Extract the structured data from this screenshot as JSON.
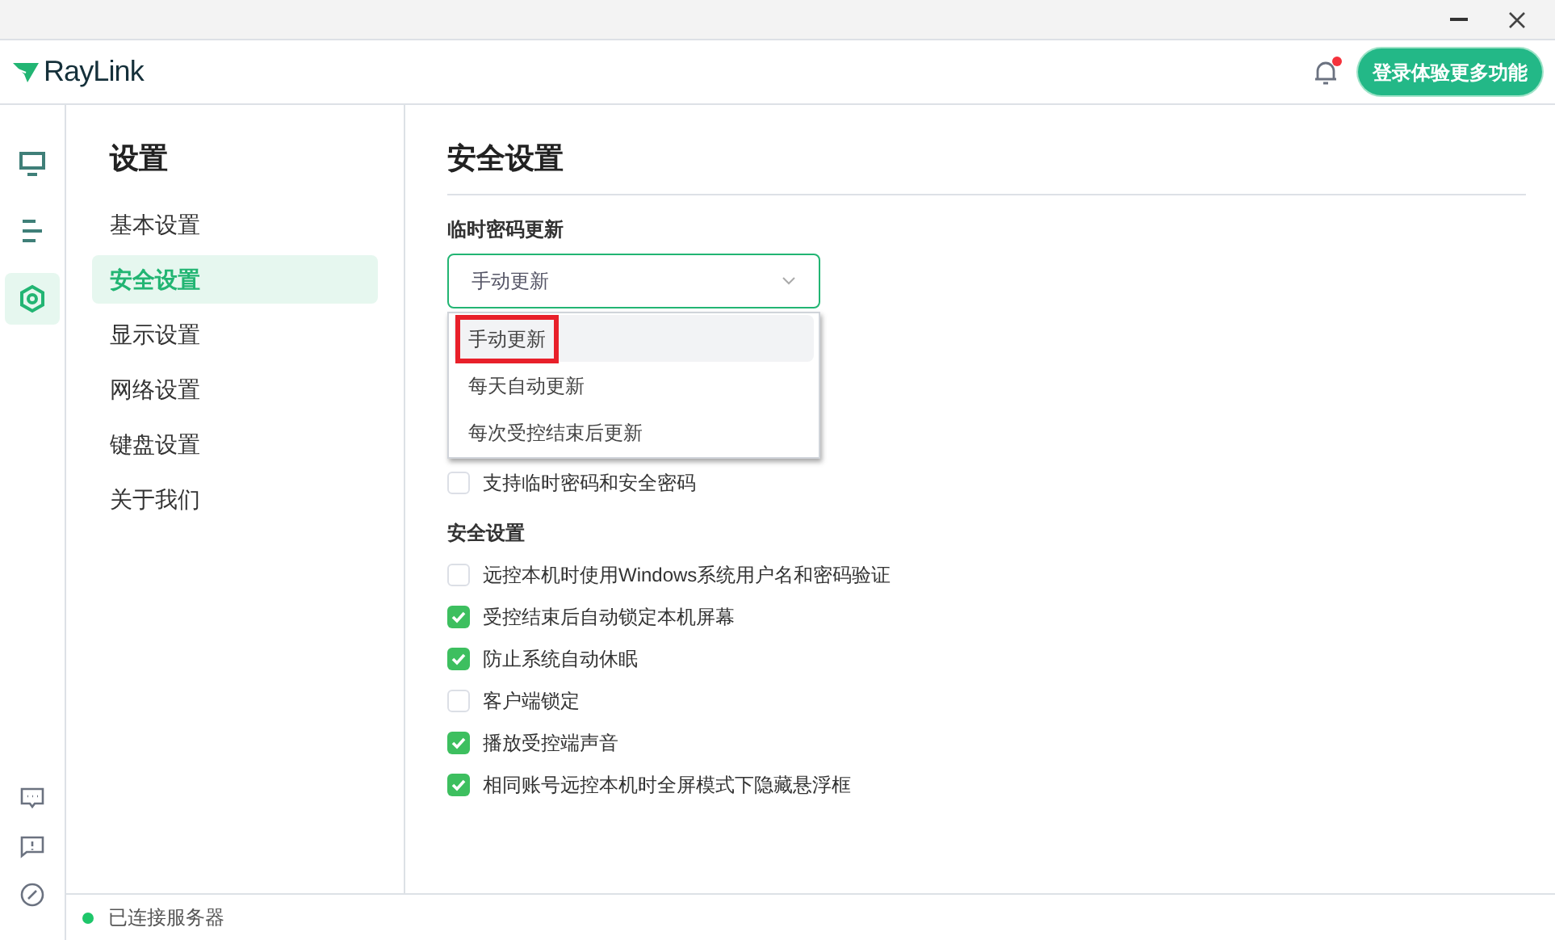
{
  "header": {
    "logo": "RayLink",
    "notification": {
      "unread": true
    },
    "login_button": "登录体验更多功能"
  },
  "rail": {
    "items": [
      {
        "kind": "monitor",
        "selected": false
      },
      {
        "kind": "list",
        "selected": false
      },
      {
        "kind": "settings",
        "selected": true
      }
    ],
    "bottom": [
      {
        "kind": "chat"
      },
      {
        "kind": "feedback"
      },
      {
        "kind": "compass"
      }
    ]
  },
  "nav": {
    "title": "设置",
    "items": [
      {
        "label": "基本设置",
        "selected": false
      },
      {
        "label": "安全设置",
        "selected": true
      },
      {
        "label": "显示设置",
        "selected": false
      },
      {
        "label": "网络设置",
        "selected": false
      },
      {
        "label": "键盘设置",
        "selected": false
      },
      {
        "label": "关于我们",
        "selected": false
      }
    ]
  },
  "content": {
    "title": "安全设置",
    "password_update": {
      "label": "临时密码更新",
      "value": "手动更新",
      "expanded": true,
      "options": [
        {
          "label": "手动更新",
          "selected": true,
          "highlighted": true
        },
        {
          "label": "每天自动更新",
          "selected": false,
          "highlighted": false
        },
        {
          "label": "每次受控结束后更新",
          "selected": false,
          "highlighted": false
        }
      ]
    },
    "partial_option": {
      "label": "支持临时密码和安全密码",
      "checked": false
    },
    "security_section": {
      "title": "安全设置",
      "options": [
        {
          "label": "远控本机时使用Windows系统用户名和密码验证",
          "checked": false
        },
        {
          "label": "受控结束后自动锁定本机屏幕",
          "checked": true
        },
        {
          "label": "防止系统自动休眠",
          "checked": true
        },
        {
          "label": "客户端锁定",
          "checked": false
        },
        {
          "label": "播放受控端声音",
          "checked": true
        },
        {
          "label": "相同账号远控本机时全屏模式下隐藏悬浮框",
          "checked": true
        }
      ]
    }
  },
  "status_bar": {
    "text": "已连接服务器",
    "connected": true
  }
}
